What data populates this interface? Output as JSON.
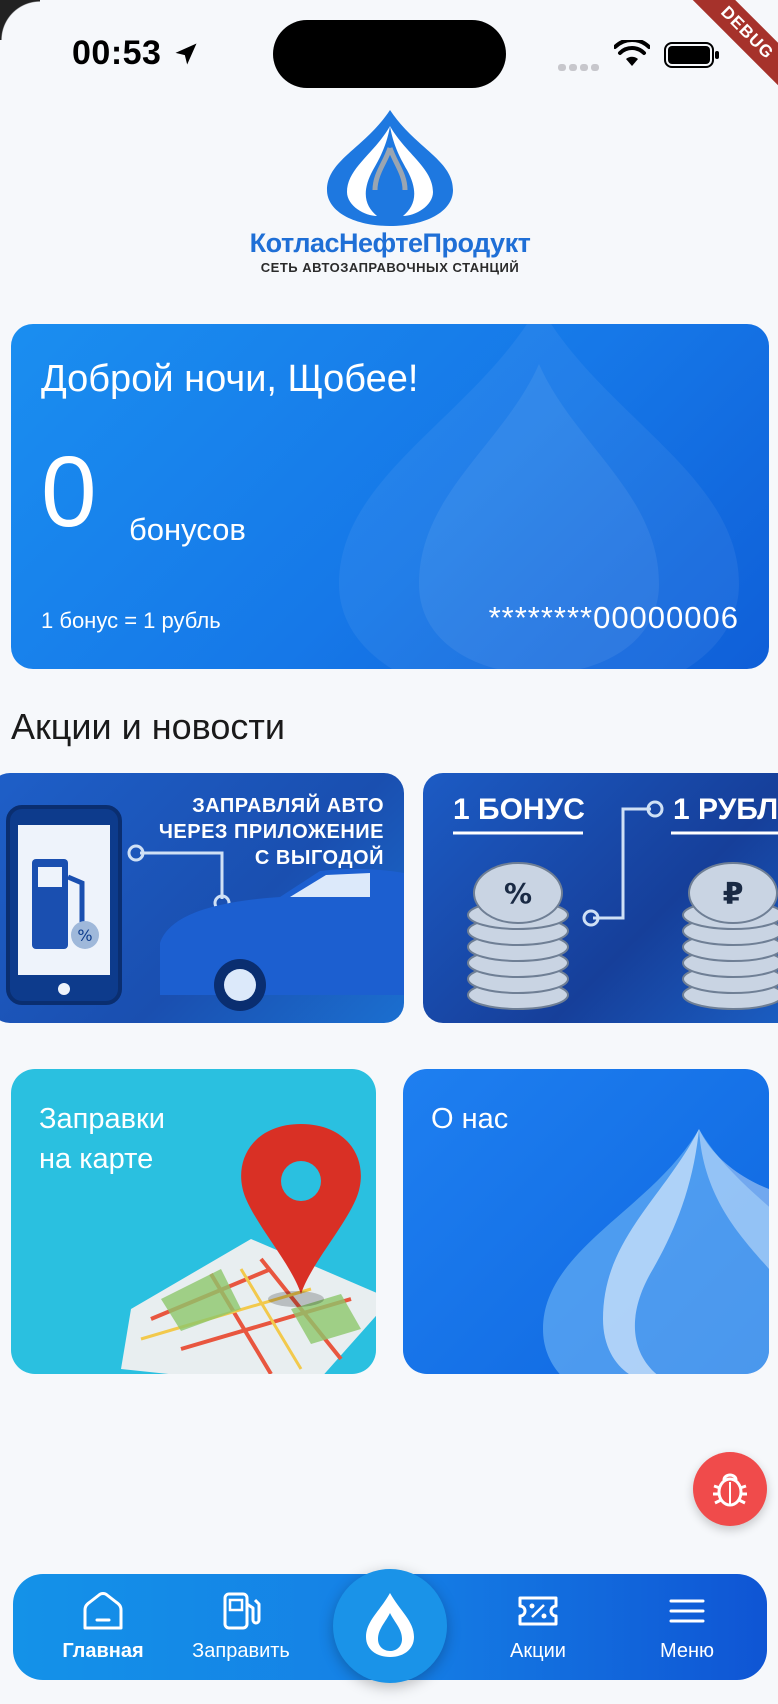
{
  "status_bar": {
    "time": "00:53",
    "icons": [
      "location-arrow-icon",
      "cellular-icon",
      "wifi-icon",
      "battery-icon"
    ],
    "debug_label": "DEBUG"
  },
  "logo": {
    "name": "КотласНефтеПродукт",
    "subtitle": "СЕТЬ АВТОЗАПРАВОЧНЫХ СТАНЦИЙ",
    "color": "#1f6fd6"
  },
  "bonus_card": {
    "greeting": "Доброй ночи, Щобее!",
    "bonus_value": "0",
    "bonus_unit": "бонусов",
    "rate": "1 бонус = 1 рубль",
    "card_number": "********00000006"
  },
  "news": {
    "title": "Акции и новости",
    "items": [
      {
        "text_lines": [
          "ЗАПРАВЛЯЙ АВТО",
          "ЧЕРЕЗ ПРИЛОЖЕНИЕ",
          "С ВЫГОДОЙ"
        ]
      },
      {
        "left": "1 БОНУС",
        "right": "1 РУБЛ"
      }
    ]
  },
  "tiles": {
    "map_label": "Заправки\nна карте",
    "about_label": "О нас"
  },
  "bottom_nav": {
    "items": [
      {
        "label": "Главная",
        "icon": "home-icon",
        "active": true
      },
      {
        "label": "Заправить",
        "icon": "fuel-pump-icon",
        "active": false
      },
      {
        "label": "Акции",
        "icon": "discount-ticket-icon",
        "active": false
      },
      {
        "label": "Меню",
        "icon": "menu-icon",
        "active": false
      }
    ],
    "center_icon": "drop-icon"
  },
  "colors": {
    "primary": "#1678e8",
    "map_tile": "#2ac0e0",
    "debug_fab": "#f04b4b"
  }
}
